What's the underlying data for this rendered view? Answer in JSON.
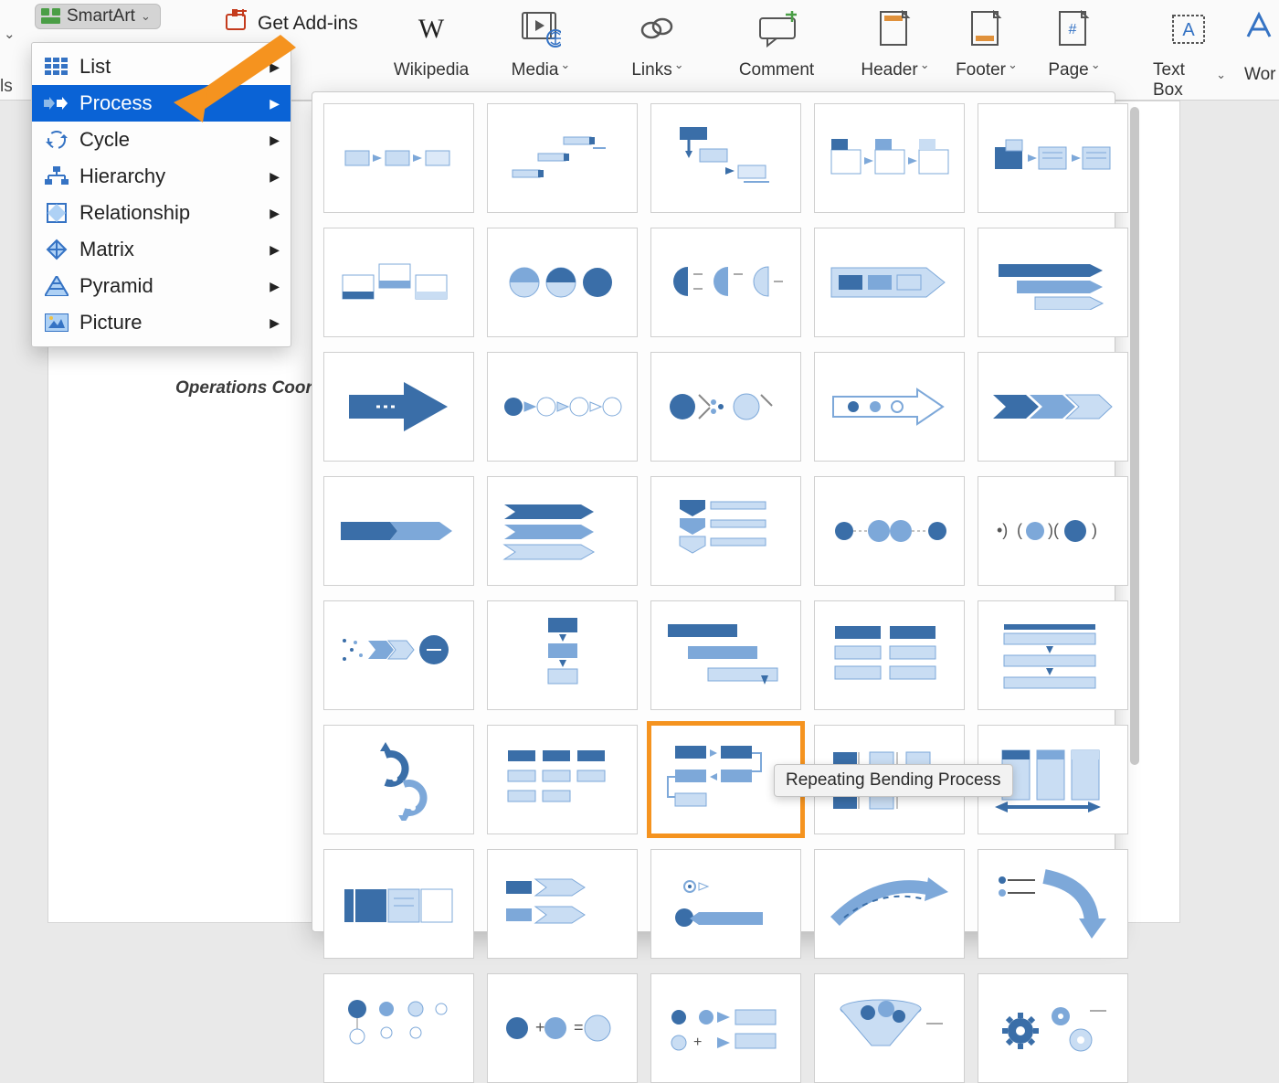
{
  "ribbon": {
    "smartart_label": "SmartArt",
    "addins_label": "Get Add-ins",
    "wikipedia_label": "Wikipedia",
    "media_label": "Media",
    "links_label": "Links",
    "comment_label": "Comment",
    "header_label": "Header",
    "footer_label": "Footer",
    "page_label": "Page",
    "textbox_label": "Text Box",
    "word_partial": "Wor",
    "left_partial": "ls"
  },
  "categories": [
    {
      "label": "List"
    },
    {
      "label": "Process"
    },
    {
      "label": "Cycle"
    },
    {
      "label": "Hierarchy"
    },
    {
      "label": "Relationship"
    },
    {
      "label": "Matrix"
    },
    {
      "label": "Pyramid"
    },
    {
      "label": "Picture"
    }
  ],
  "document": {
    "visible_text": "Operations Coord"
  },
  "gallery": {
    "highlighted_name": "Repeating Bending Process",
    "tooltip": "Repeating Bending Process"
  },
  "colors": {
    "accent": "#0a63d6",
    "highlight": "#f5931f",
    "blue_light": "#c9ddf3",
    "blue_mid": "#7da8d9",
    "blue_dark": "#3a6ea8"
  }
}
